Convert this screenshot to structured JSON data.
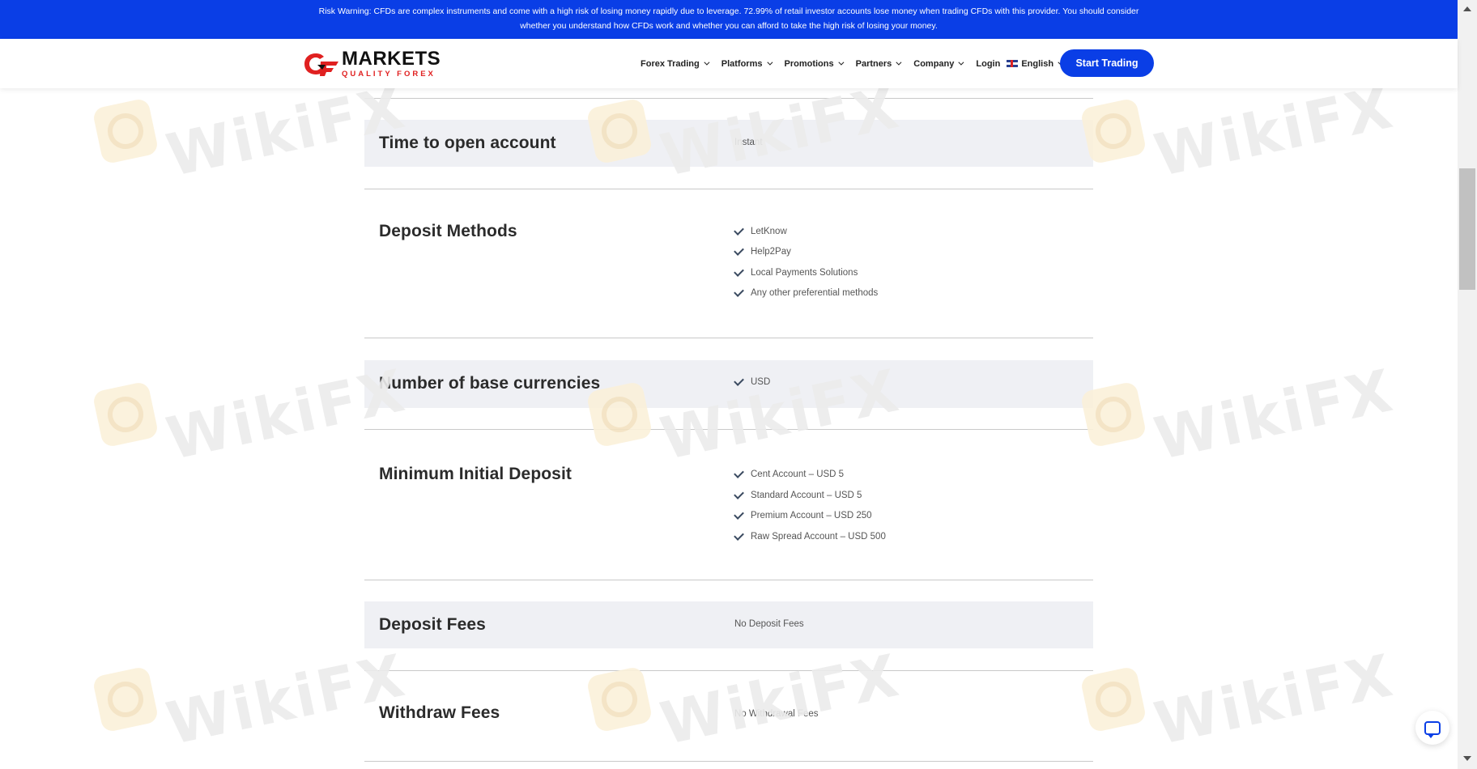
{
  "risk_warning": {
    "line1": "Risk Warning: CFDs are complex instruments and come with a high risk of losing money rapidly due to leverage. 72.99% of retail investor accounts lose money when trading CFDs with this provider. You should consider",
    "line2": "whether you understand how CFDs work and whether you can afford to take the high risk of losing your money."
  },
  "header": {
    "logo_main": "MARKETS",
    "logo_sub": "QUALITY FOREX",
    "nav": [
      "Forex Trading",
      "Platforms",
      "Promotions",
      "Partners",
      "Company"
    ],
    "login": "Login",
    "language": "English",
    "cta": "Start Trading"
  },
  "rows": {
    "time_to_open": {
      "title": "Time to open account",
      "value": "Instant"
    },
    "deposit_methods": {
      "title": "Deposit Methods",
      "items": [
        "LetKnow",
        "Help2Pay",
        "Local Payments Solutions",
        "Any other preferential methods"
      ]
    },
    "base_currencies": {
      "title": "Number of base currencies",
      "items": [
        "USD"
      ]
    },
    "min_deposit": {
      "title": "Minimum Initial Deposit",
      "items": [
        "Cent Account – USD 5",
        "Standard Account – USD 5",
        "Premium Account – USD 250",
        "Raw Spread Account – USD 500"
      ]
    },
    "deposit_fees": {
      "title": "Deposit Fees",
      "value": "No Deposit Fees"
    },
    "withdraw_fees": {
      "title": "Withdraw Fees",
      "value": "No Withdrawal Fees"
    }
  },
  "watermark": "WikiFX",
  "colors": {
    "brand_blue": "#0a3ee6",
    "logo_red": "#e02020",
    "row_shade": "#eff0f4"
  },
  "icons": {
    "check": "check-icon",
    "chat": "chat-icon",
    "flag": "uk-flag-icon"
  }
}
